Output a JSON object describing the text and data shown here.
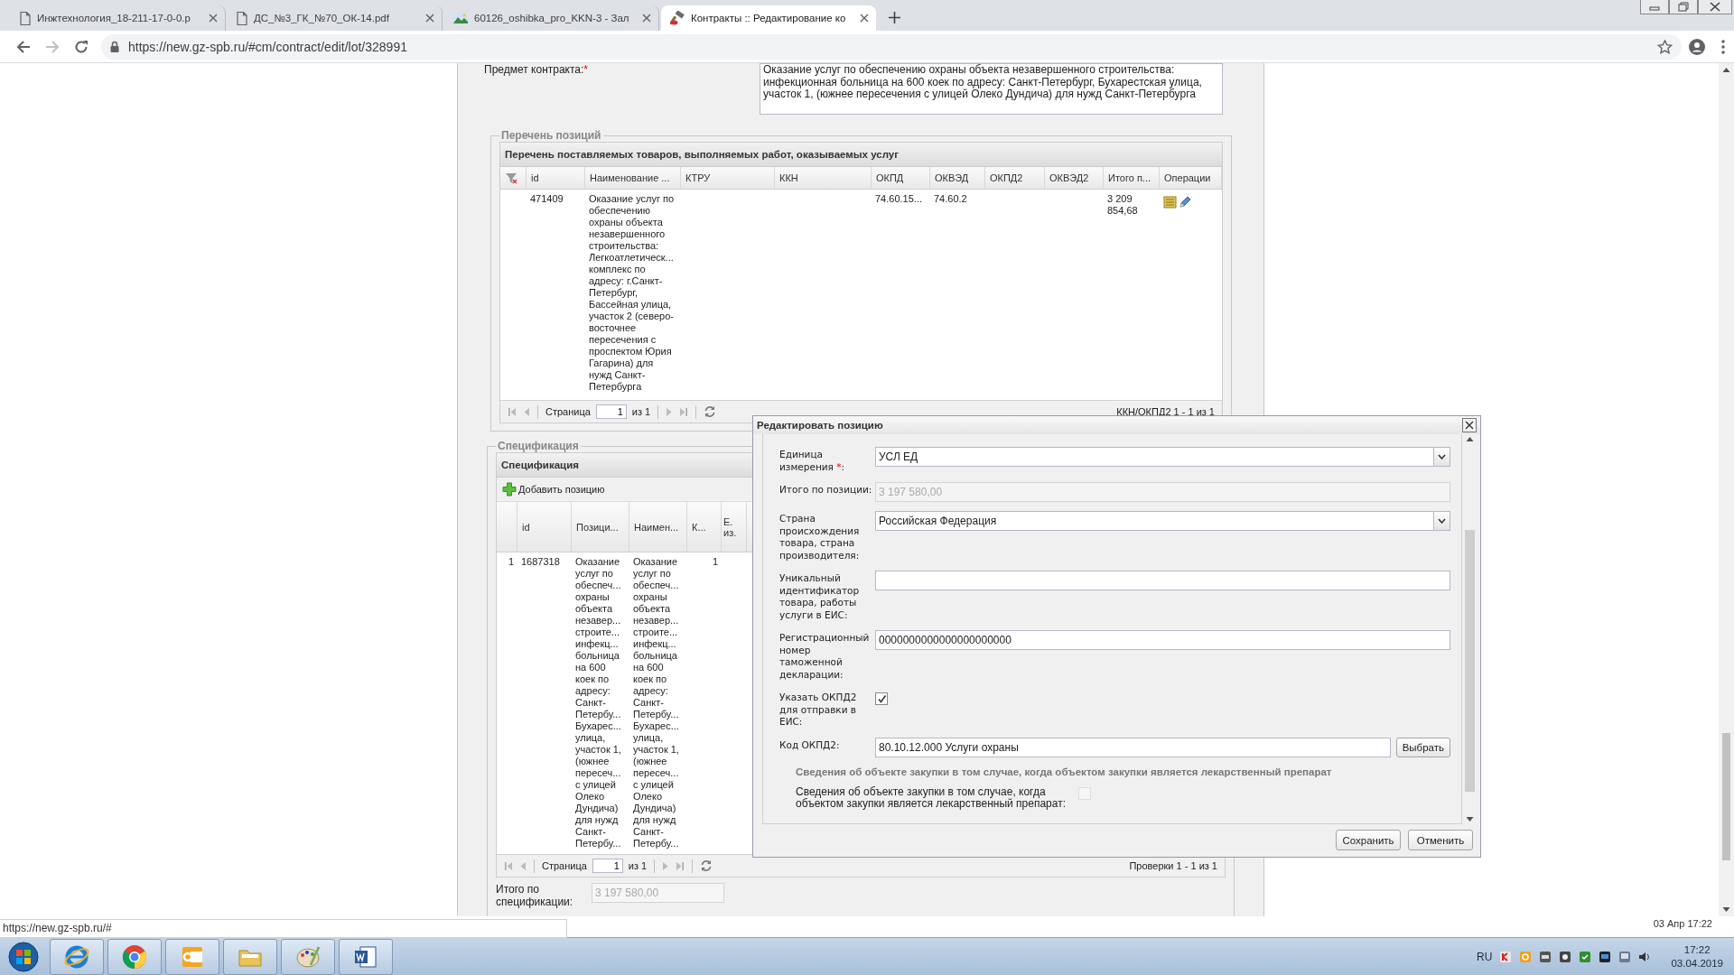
{
  "browser": {
    "tabs": [
      {
        "title": "Инжтехнология_18-211-17-0-0.p",
        "selected": false
      },
      {
        "title": "ДС_№3_ГК_№70_ОК-14.pdf",
        "selected": false
      },
      {
        "title": "60126_oshibka_pro_KKN-3 - Зал",
        "selected": false
      },
      {
        "title": "Контракты :: Редактирование ко",
        "selected": true
      }
    ],
    "url": "https://new.gz-spb.ru/#cm/contract/edit/lot/328991"
  },
  "contract": {
    "subject_label": "Предмет контракта:",
    "required_mark": "*",
    "subject": "Оказание услуг по обеспечению охраны объекта незавершенного строительства: инфекционная больница на 600 коек по адресу: Санкт-Петербург, Бухарестская улица, участок 1, (южнее пересечения с улицей Олеко Дундича) для нужд Санкт-Петербурга"
  },
  "positions": {
    "legend": "Перечень позиций",
    "title": "Перечень поставляемых товаров, выполняемых работ, оказываемых услуг",
    "columns": [
      null,
      "id",
      "Наименование ...",
      "КТРУ",
      "ККН",
      "ОКПД",
      "ОКВЭД",
      "ОКПД2",
      "ОКВЭД2",
      "Итого п...",
      "Операции"
    ],
    "rows": [
      {
        "cells": [
          null,
          "471409",
          "Оказание услуг по обеспечению охраны объекта незавершенного строительства: Легкоатлетическ... комплекс по адресу: г.Санкт-Петербург, Бассейная улица, участок 2 (северо-восточнее пересечения с проспектом Юрия Гагарина) для нужд Санкт-Петербурга",
          null,
          null,
          "74.60.15...",
          "74.60.2",
          null,
          null,
          "3 209 854,68",
          null
        ]
      }
    ],
    "pager": {
      "page_label": "Страница",
      "page": "1",
      "of": "из 1",
      "summary": "ККН/ОКПД2 1 - 1 из 1"
    }
  },
  "specification": {
    "legend": "Спецификация",
    "title": "Спецификация",
    "add_button": "Добавить позицию",
    "columns": [
      null,
      "id",
      "Позици...",
      "Наимен...",
      "К...",
      "Е. из."
    ],
    "rows": [
      {
        "cells": [
          "1",
          "1687318",
          "Оказание услуг по обеспеч... охраны объекта незавер... строите... инфекц... больница на 600 коек по адресу: Санкт-Петербу... Бухарес... улица, участок 1, (южнее пересеч... с улицей Олеко Дундича) для нужд Санкт-Петербу...",
          "Оказание услуг по обеспеч... охраны объекта незавер... строите... инфекц... больница на 600 коек по адресу: Санкт-Петербу... Бухарес... улица, участок 1, (южнее пересеч... с улицей Олеко Дундича) для нужд Санкт-Петербу...",
          "1",
          null
        ]
      }
    ],
    "pager": {
      "page_label": "Страница",
      "page": "1",
      "of": "из 1",
      "summary": "Проверки 1 - 1 из 1"
    },
    "total_label": "Итого по спецификации:",
    "total": "3 197 580,00"
  },
  "dialog": {
    "title": "Редактировать позицию",
    "fields": [
      {
        "kind": "combo",
        "label": "Единица измерения ",
        "required_mark": "*",
        "label_end": ":",
        "value": "УСЛ ЕД"
      },
      {
        "kind": "text",
        "label": "Итого по позиции:",
        "value": "3 197 580,00",
        "disabled": true
      },
      {
        "kind": "combo",
        "label": "Страна происхождения товара, страна производителя:",
        "value": "Российская Федерация"
      },
      {
        "kind": "text",
        "label": "Уникальный идентификатор товара, работы услуги в ЕИС:"
      },
      {
        "kind": "text",
        "label": "Регистрационный номер таможенной декларации:",
        "value": "0000000000000000000000"
      },
      {
        "kind": "checkbox",
        "label": "Указать ОКПД2 для отправки в ЕИС:",
        "checked": true
      },
      {
        "kind": "picker",
        "label": "Код ОКПД2:",
        "value": "80.10.12.000 Услуги охраны",
        "button": "Выбрать"
      }
    ],
    "section_title": "Сведения об объекте закупки в том случае, когда объектом закупки является лекарственный препарат",
    "drug": {
      "label": "Сведения об объекте закупки в том случае, когда объектом закупки является лекарственный препарат:",
      "checked": false,
      "disabled": true
    },
    "buttons": [
      "Сохранить",
      "Отменить"
    ]
  },
  "status": {
    "url": "https://new.gz-spb.ru/#",
    "datetime": "03 Апр 17:22"
  },
  "taskbar": {
    "language": "RU",
    "time": "17:22",
    "date": "03.04.2019"
  }
}
